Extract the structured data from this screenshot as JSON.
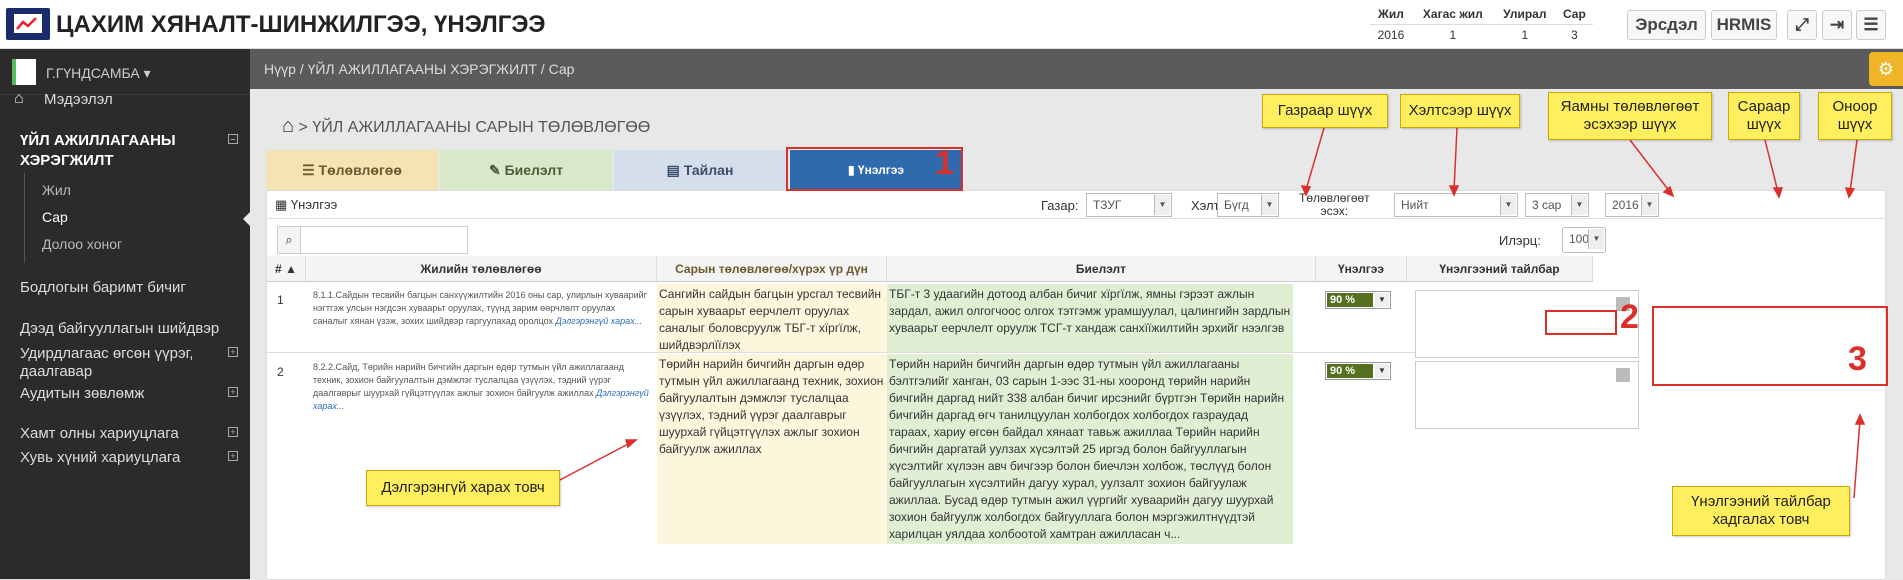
{
  "app": {
    "title": "ЦАХИМ ХЯНАЛТ-ШИНЖИЛГЭЭ, ҮНЭЛГЭЭ"
  },
  "period": {
    "headers": [
      "Жил",
      "Хагас жил",
      "Улирал",
      "Сар"
    ],
    "values": [
      "2016",
      "1",
      "1",
      "3"
    ]
  },
  "topbuttons": {
    "risk": "Эрсдэл",
    "hrmis": "HRMIS"
  },
  "user": {
    "name": "Г.ГҮНДСАМБА"
  },
  "sidebar": {
    "info": "Мэдээлэл",
    "activity": "ҮЙЛ АЖИЛЛАГААНЫ ХЭРЭГЖИЛТ",
    "sub": [
      "Жил",
      "Сар",
      "Долоо хоног"
    ],
    "items": [
      "Бодлогын баримт бичиг",
      "Дээд байгууллагын шийдвэр",
      "Удирдлагаас өгсөн үүрэг, даалгавар",
      "Аудитын зөвлөмж",
      "Хамт олны хариуцлага",
      "Хувь хүний хариуцлага"
    ]
  },
  "breadcrumb": {
    "home": "Нүүр",
    "activity": "ҮЙЛ АЖИЛЛАГААНЫ ХЭРЭГЖИЛТ",
    "month": "Сар"
  },
  "page": {
    "title": "> ҮЙЛ АЖИЛЛАГААНЫ САРЫН ТӨЛӨВЛӨГӨӨ"
  },
  "tabs": {
    "plan": "Төлөвлөгөө",
    "exec": "Биелэлт",
    "report": "Тайлан",
    "eval": "Үнэлгээ"
  },
  "filters": {
    "section": "Үнэлгээ",
    "place_label": "Газар:",
    "place_value": "ТЗУГ",
    "scale_label": "Хэлтэс:",
    "scale_value": "Бүгд",
    "plan_label_1": "Төлөвлөгөөт",
    "plan_label_2": "эсэх:",
    "plan_value": "Нийт",
    "month_value": "3 сар",
    "year_value": "2016",
    "page_size_label": "Илэрц:",
    "page_size_value": "100"
  },
  "table": {
    "headers": [
      "#",
      "Жилийн төлөвлөгөө",
      "Сарын төлөвлөгөө/хүрэх үр дүн",
      "Биелэлт",
      "Үнэлгээ",
      "Үнэлгээний тайлбар"
    ],
    "rows": [
      {
        "no": "1",
        "annual": "8.1.1.Сайдын тесвийн багцын санхүүжилтийн 2016 оны сар, улирлын хуваарийг нэгтгэж улсын нэгдсэн хуваарьт оруулах, түүнд зарим өөрчлөлт оруулах саналыг хянан үзэж, зохих шийдвэр гаргуулахад оролцох",
        "more": "Дэлгэрэнгүй харах...",
        "monthly": "Сангийн сайдын багцын урсгал тесвийн сарын хуваарьт еерчлелт оруулах саналыг боловсруулж ТБГ-т хїргїлж, шийдвэрлїїлэх",
        "exec": "ТБГ-т 3 удаагийн дотоод албан бичиг хїргїлж, ямны гэрээт ажлын зардал, ажил олгогчоос олгох тэтгэмж урамшуулал, цалингийн зардлын хуваарьт еерчлелт оруулж ТСГ-т хандаж санхїїжилтийн эрхийг нээлгэв",
        "rating": "90 %"
      },
      {
        "no": "2",
        "annual": "8.2.2.Сайд, Төрийн нарийн бичгийн даргын өдөр тутмын үйл ажиллагаанд техник, зохион байгуулалтын дэмжлэг туслалцаа үзүүлэх, тэдний үүрэг даалгаврыг шуурхай гүйцэтгүүлэх ажлыг зохион байгуулж ажиллах",
        "more": "Дэлгэрэнгүй харах...",
        "monthly": "Төрийн нарийн бичгийн даргын өдөр тутмын үйл ажиллагаанд техник, зохион байгуулалтын дэмжлэг туслалцаа үзүүлэх, тэдний үүрэг даалгаврыг шуурхай гүйцэтгүүлэх ажлыг зохион байгуулж ажиллах",
        "exec": "Төрийн нарийн бичгийн даргын өдөр тутмын үйл ажиллагааны бэлтгэлийг ханган, 03 сарын 1-ээс 31-ны хооронд төрийн нарийн бичгийн даргад нийт 338 албан бичиг ирсэнийг бүртгэн Төрийн нарийн бичгийн даргад өгч танилцуулан холбогдох холбогдох газраудад тараах, хариу өгсөн байдал хянаат тавьж ажиллаа Төрийн нарийн бичгийн даргатай уулзах хүсэлтэй 25 иргэд болон байгууллагын хүсэлтийг хүлээн авч бичгээр болон биечлэн холбож, төслүүд болон байгууллагын хүсэлтийн дагуу хурал, уулзалт зохион байгуулаж ажиллаа. Бусад өдөр тутмын ажил үүргийг хуваарийн дагуу шуурхай зохион байгуулж холбогдох байгууллага болон мэргэжилтнүүдтэй харилцан уялдаа холбоотой хамтран ажилласан ч...",
        "rating": "90 %"
      }
    ]
  },
  "callouts": {
    "place": "Газраар шүүх",
    "dept": "Хэлтсээр шүүх",
    "plan": "Яамны төлөвлөгөөт эсэхээр шүүх",
    "month": "Сараар шүүх",
    "year": "Оноор шүүх",
    "detail": "Дэлгэрэнгүй харах товч",
    "save": "Үнэлгээний тайлбар хадгалах товч"
  },
  "markers": [
    "1",
    "2",
    "3"
  ],
  "colors": {
    "accent": "#2f6aad",
    "sidebar": "#2b2b2b",
    "callout": "#ffef5f",
    "marker": "#d9302c",
    "rating": "#55701e"
  }
}
